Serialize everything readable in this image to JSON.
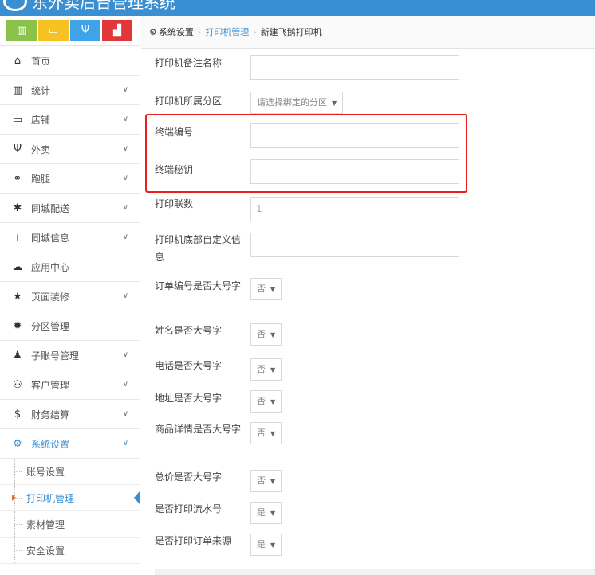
{
  "app": {
    "title": "东外卖后台管理系统"
  },
  "colors": {
    "brand": "#3a8fd3",
    "highlight": "#e8211c"
  },
  "quick_buttons": [
    {
      "icon": "bar-chart-icon",
      "glyph": "▥",
      "color": "green"
    },
    {
      "icon": "monitor-icon",
      "glyph": "▭",
      "color": "yellow"
    },
    {
      "icon": "fork-knife-icon",
      "glyph": "Ψ",
      "color": "blue"
    },
    {
      "icon": "bag-icon",
      "glyph": "▟",
      "color": "red"
    }
  ],
  "sidebar": {
    "items": [
      {
        "label": "首页",
        "icon": "home-icon",
        "glyph": "⌂",
        "has_chevron": false
      },
      {
        "label": "统计",
        "icon": "bar-chart-icon",
        "glyph": "▥",
        "has_chevron": true
      },
      {
        "label": "店铺",
        "icon": "monitor-icon",
        "glyph": "▭",
        "has_chevron": true
      },
      {
        "label": "外卖",
        "icon": "fork-knife-icon",
        "glyph": "Ψ",
        "has_chevron": true
      },
      {
        "label": "跑腿",
        "icon": "bicycle-icon",
        "glyph": "⚭",
        "has_chevron": true
      },
      {
        "label": "同城配送",
        "icon": "asterisk-icon",
        "glyph": "✱",
        "has_chevron": true
      },
      {
        "label": "同城信息",
        "icon": "info-icon",
        "glyph": "i",
        "has_chevron": true
      },
      {
        "label": "应用中心",
        "icon": "cloud-icon",
        "glyph": "☁",
        "has_chevron": false
      },
      {
        "label": "页面装修",
        "icon": "star-icon",
        "glyph": "★",
        "has_chevron": true
      },
      {
        "label": "分区管理",
        "icon": "gear-badge-icon",
        "glyph": "✹",
        "has_chevron": false
      },
      {
        "label": "子账号管理",
        "icon": "user-icon",
        "glyph": "♟",
        "has_chevron": true
      },
      {
        "label": "客户管理",
        "icon": "users-icon",
        "glyph": "⚇",
        "has_chevron": true
      },
      {
        "label": "财务结算",
        "icon": "dollar-icon",
        "glyph": "$",
        "has_chevron": true
      },
      {
        "label": "系统设置",
        "icon": "gear-icon",
        "glyph": "⚙",
        "has_chevron": true,
        "active": true
      }
    ],
    "sub_items": [
      {
        "label": "账号设置"
      },
      {
        "label": "打印机管理",
        "current": true
      },
      {
        "label": "素材管理"
      },
      {
        "label": "安全设置"
      }
    ]
  },
  "breadcrumb": {
    "root": "系统设置",
    "parent": "打印机管理",
    "current": "新建飞鹅打印机",
    "separator": "›"
  },
  "form": {
    "fields": [
      {
        "key": "remark",
        "label": "打印机备注名称",
        "type": "text",
        "value": ""
      },
      {
        "key": "zone",
        "label": "打印机所属分区",
        "type": "select",
        "value": "请选择绑定的分区"
      },
      {
        "key": "terminal_no",
        "label": "终端编号",
        "type": "text",
        "value": ""
      },
      {
        "key": "terminal_key",
        "label": "终端秘钥",
        "type": "text",
        "value": ""
      },
      {
        "key": "copies",
        "label": "打印联数",
        "type": "text",
        "value": "1"
      },
      {
        "key": "footer",
        "label": "打印机底部自定义信息",
        "type": "text",
        "value": ""
      },
      {
        "key": "order_no_big",
        "label": "订单编号是否大号字",
        "type": "select",
        "value": "否"
      },
      {
        "key": "name_big",
        "label": "姓名是否大号字",
        "type": "select",
        "value": "否"
      },
      {
        "key": "phone_big",
        "label": "电话是否大号字",
        "type": "select",
        "value": "否"
      },
      {
        "key": "address_big",
        "label": "地址是否大号字",
        "type": "select",
        "value": "否"
      },
      {
        "key": "detail_big",
        "label": "商品详情是否大号字",
        "type": "select",
        "value": "否"
      },
      {
        "key": "total_big",
        "label": "总价是否大号字",
        "type": "select",
        "value": "否"
      },
      {
        "key": "print_serial",
        "label": "是否打印流水号",
        "type": "select",
        "value": "是"
      },
      {
        "key": "print_source",
        "label": "是否打印订单来源",
        "type": "select",
        "value": "是"
      }
    ]
  }
}
